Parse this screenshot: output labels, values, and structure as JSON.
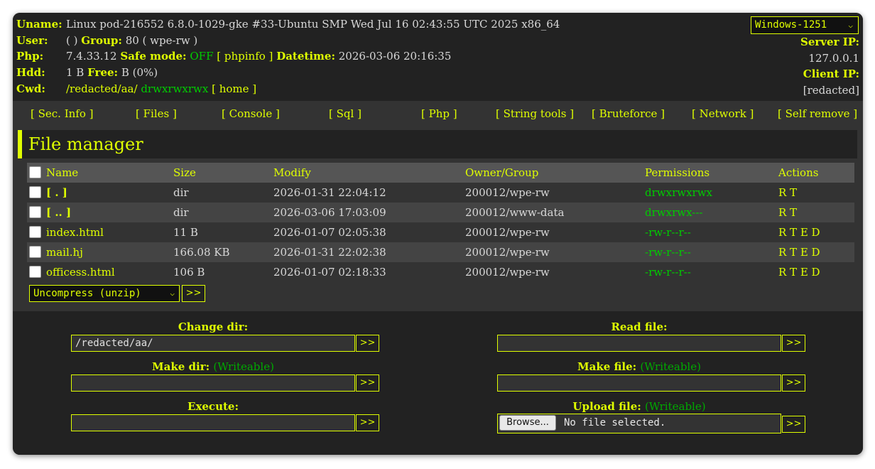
{
  "header": {
    "uname_label": "Uname:",
    "uname_value": "Linux pod-216552 6.8.0-1029-gke #33-Ubuntu SMP Wed Jul 16 02:43:55 UTC 2025 x86_64",
    "user_label": "User:",
    "user_value": "( )",
    "group_label": "Group:",
    "group_value": "80 ( wpe-rw )",
    "php_label": "Php:",
    "php_value": "7.4.33.12",
    "safe_mode_label": "Safe mode:",
    "safe_mode_value": "OFF",
    "phpinfo_link": "[ phpinfo ]",
    "datetime_label": "Datetime:",
    "datetime_value": "2026-03-06 20:16:35",
    "hdd_label": "Hdd:",
    "hdd_value": "1 B",
    "free_label": "Free:",
    "free_value": "B (0%)",
    "cwd_label": "Cwd:",
    "cwd_path": "/redacted/aa/",
    "cwd_perms": "drwxrwxrwx",
    "home_link": "[ home ]",
    "charset_selected": "Windows-1251",
    "server_ip_label": "Server IP:",
    "server_ip_value": "127.0.0.1",
    "client_ip_label": "Client IP:",
    "client_ip_value": "[redacted]"
  },
  "menu": [
    "[ Sec. Info ]",
    "[ Files ]",
    "[ Console ]",
    "[ Sql ]",
    "[ Php ]",
    "[ String tools ]",
    "[ Bruteforce ]",
    "[ Network ]",
    "[ Self remove ]"
  ],
  "file_manager": {
    "title": "File manager",
    "columns": [
      "Name",
      "Size",
      "Modify",
      "Owner/Group",
      "Permissions",
      "Actions"
    ],
    "rows": [
      {
        "name": "[ . ]",
        "size": "dir",
        "modify": "2026-01-31 22:04:12",
        "owner": "200012/wpe-rw",
        "perms": "drwxrwxrwx",
        "actions": "R T"
      },
      {
        "name": "[ .. ]",
        "size": "dir",
        "modify": "2026-03-06 17:03:09",
        "owner": "200012/www-data",
        "perms": "drwxrwx---",
        "actions": "R T"
      },
      {
        "name": "index.html",
        "size": "11 B",
        "modify": "2026-01-07 02:05:38",
        "owner": "200012/wpe-rw",
        "perms": "-rw-r--r--",
        "actions": "R T E D"
      },
      {
        "name": "mail.hj",
        "size": "166.08 KB",
        "modify": "2026-01-31 22:02:38",
        "owner": "200012/wpe-rw",
        "perms": "-rw-r--r--",
        "actions": "R T E D"
      },
      {
        "name": "officess.html",
        "size": "106 B",
        "modify": "2026-01-07 02:18:33",
        "owner": "200012/wpe-rw",
        "perms": "-rw-r--r--",
        "actions": "R T E D"
      }
    ],
    "action_selected": "Uncompress (unzip)",
    "go_label": ">>"
  },
  "tools": {
    "change_dir_label": "Change dir:",
    "change_dir_value": "/redacted/aa/",
    "read_file_label": "Read file:",
    "make_dir_label": "Make dir:",
    "make_dir_note": "(Writeable)",
    "make_file_label": "Make file:",
    "make_file_note": "(Writeable)",
    "execute_label": "Execute:",
    "upload_file_label": "Upload file:",
    "upload_file_note": "(Writeable)",
    "browse_label": "Browse...",
    "no_file_text": "No file selected.",
    "go_label": ">>"
  },
  "colors": {
    "accent": "#dfff00",
    "green": "#00cc00",
    "background": "#222222",
    "panel": "#333333"
  }
}
